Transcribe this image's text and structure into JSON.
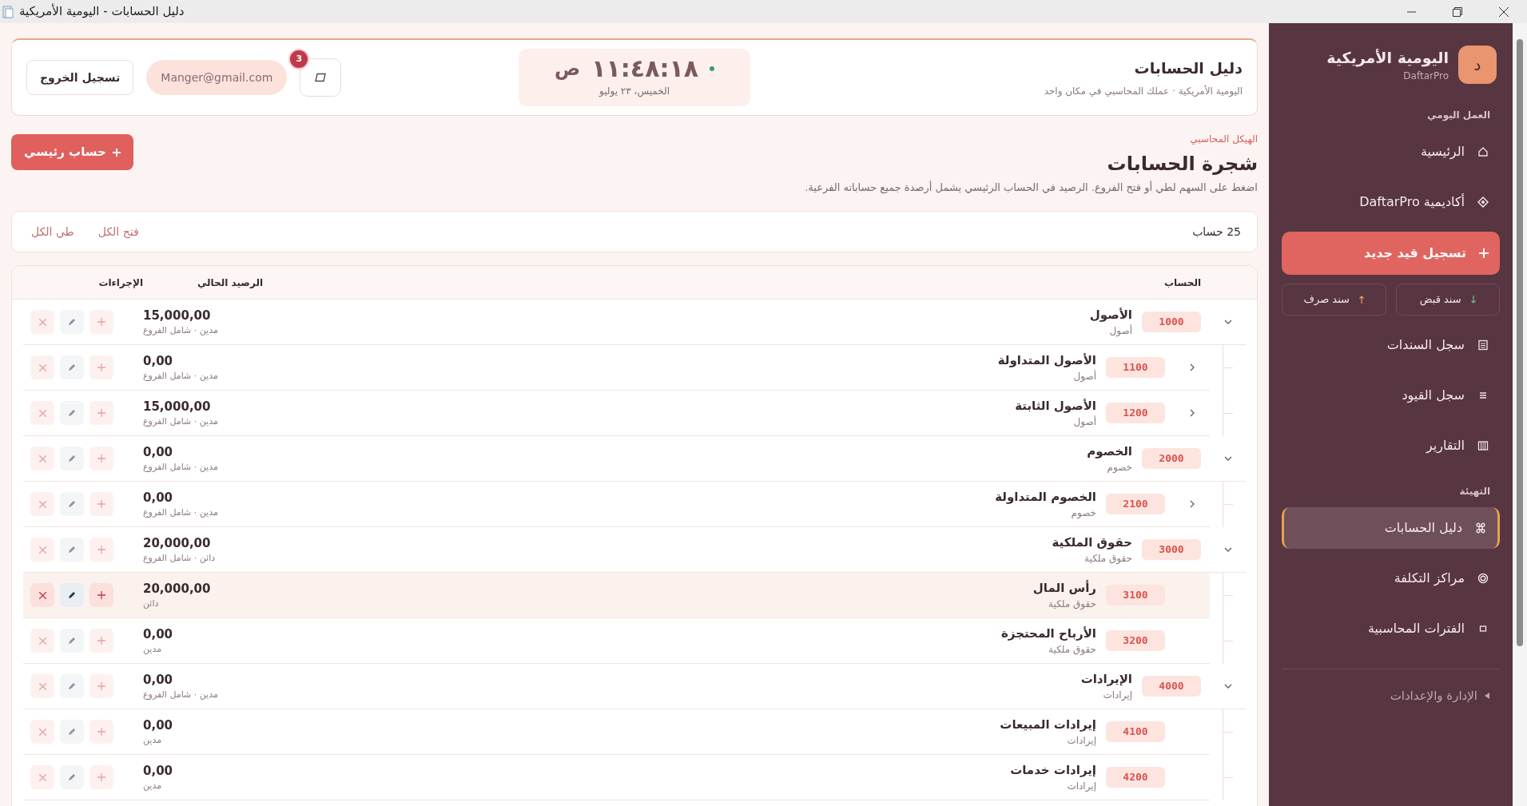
{
  "window": {
    "title": "دليل الحسابات - اليومية الأمريكية"
  },
  "header": {
    "title": "دليل الحسابات",
    "subtitle": "اليومية الأمريكية · عملك المحاسبي في مكان واحد",
    "clock": {
      "time": "١١:٤٨:١٨",
      "period": "ص",
      "date": "الخميس، ٢٣ يوليو"
    },
    "notifications": "3",
    "email": "Manger@gmail.com",
    "logout": "تسجيل الخروج"
  },
  "page": {
    "breadcrumb": "الهيكل المحاسبي",
    "title": "شجرة الحسابات",
    "description": "اضغط على السهم لطي أو فتح الفروع. الرصيد في الحساب الرئيسي يشمل أرصدة جميع حساباته الفرعية.",
    "add_button": "حساب رئيسي"
  },
  "toolbar": {
    "count": "25 حساب",
    "expand_all": "فتح الكل",
    "collapse_all": "طي الكل"
  },
  "table": {
    "columns": [
      "الحساب",
      "الرصيد الحالي",
      "الإجراءات"
    ],
    "accounts": [
      {
        "code": "1000",
        "name": "الأصول",
        "type": "أصول",
        "balance": "15,000,00",
        "note": "مدين · شامل الفروع",
        "kind": "parent",
        "expanded": true,
        "selected": false,
        "children": [
          {
            "code": "1100",
            "name": "الأصول المتداولة",
            "type": "أصول",
            "balance": "0,00",
            "note": "مدين · شامل الفروع",
            "kind": "parent",
            "expanded": false,
            "selected": false
          },
          {
            "code": "1200",
            "name": "الأصول الثابتة",
            "type": "أصول",
            "balance": "15,000,00",
            "note": "مدين · شامل الفروع",
            "kind": "parent",
            "expanded": false,
            "selected": false
          }
        ]
      },
      {
        "code": "2000",
        "name": "الخصوم",
        "type": "خصوم",
        "balance": "0,00",
        "note": "مدين · شامل الفروع",
        "kind": "parent",
        "expanded": true,
        "selected": false,
        "children": [
          {
            "code": "2100",
            "name": "الخصوم المتداولة",
            "type": "خصوم",
            "balance": "0,00",
            "note": "مدين · شامل الفروع",
            "kind": "parent",
            "expanded": false,
            "selected": false
          }
        ]
      },
      {
        "code": "3000",
        "name": "حقوق الملكية",
        "type": "حقوق ملكية",
        "balance": "20,000,00",
        "note": "دائن · شامل الفروع",
        "kind": "parent",
        "expanded": true,
        "selected": false,
        "children": [
          {
            "code": "3100",
            "name": "رأس المال",
            "type": "حقوق ملكية",
            "balance": "20,000,00",
            "note": "دائن",
            "kind": "leaf",
            "selected": true
          },
          {
            "code": "3200",
            "name": "الأرباح المحتجزة",
            "type": "حقوق ملكية",
            "balance": "0,00",
            "note": "مدين",
            "kind": "leaf",
            "selected": false
          }
        ]
      },
      {
        "code": "4000",
        "name": "الإيرادات",
        "type": "إيرادات",
        "balance": "0,00",
        "note": "مدين · شامل الفروع",
        "kind": "parent",
        "expanded": true,
        "selected": false,
        "children": [
          {
            "code": "4100",
            "name": "إيرادات المبيعات",
            "type": "إيرادات",
            "balance": "0,00",
            "note": "مدين",
            "kind": "leaf",
            "selected": false
          },
          {
            "code": "4200",
            "name": "إيرادات خدمات",
            "type": "إيرادات",
            "balance": "0,00",
            "note": "مدين",
            "kind": "leaf",
            "selected": false
          }
        ]
      }
    ]
  },
  "sidebar": {
    "logo": "د",
    "brand": "اليومية الأمريكية",
    "product": "DaftarPro",
    "sections": [
      {
        "title": "العمل اليومي",
        "items": [
          {
            "kind": "nav",
            "label": "الرئيسية",
            "selected": false
          },
          {
            "kind": "nav",
            "label": "أكاديمية DaftarPro",
            "selected": false
          },
          {
            "kind": "action",
            "label": "تسجيل قيد جديد"
          },
          {
            "kind": "vouchers",
            "buttons": [
              "سند قبض",
              "سند صرف"
            ]
          },
          {
            "kind": "nav",
            "label": "سجل السندات",
            "selected": false
          },
          {
            "kind": "nav",
            "label": "سجل القيود",
            "selected": false
          },
          {
            "kind": "nav",
            "label": "التقارير",
            "selected": false
          }
        ]
      },
      {
        "title": "التهيئة",
        "items": [
          {
            "kind": "nav",
            "label": "دليل الحسابات",
            "selected": true
          },
          {
            "kind": "nav",
            "label": "مراكز التكلفة",
            "selected": false
          },
          {
            "kind": "nav",
            "label": "الفترات المحاسبية",
            "selected": false
          }
        ]
      }
    ],
    "collapsible": {
      "label": "الإدارة والإعدادات",
      "expanded": false
    }
  }
}
